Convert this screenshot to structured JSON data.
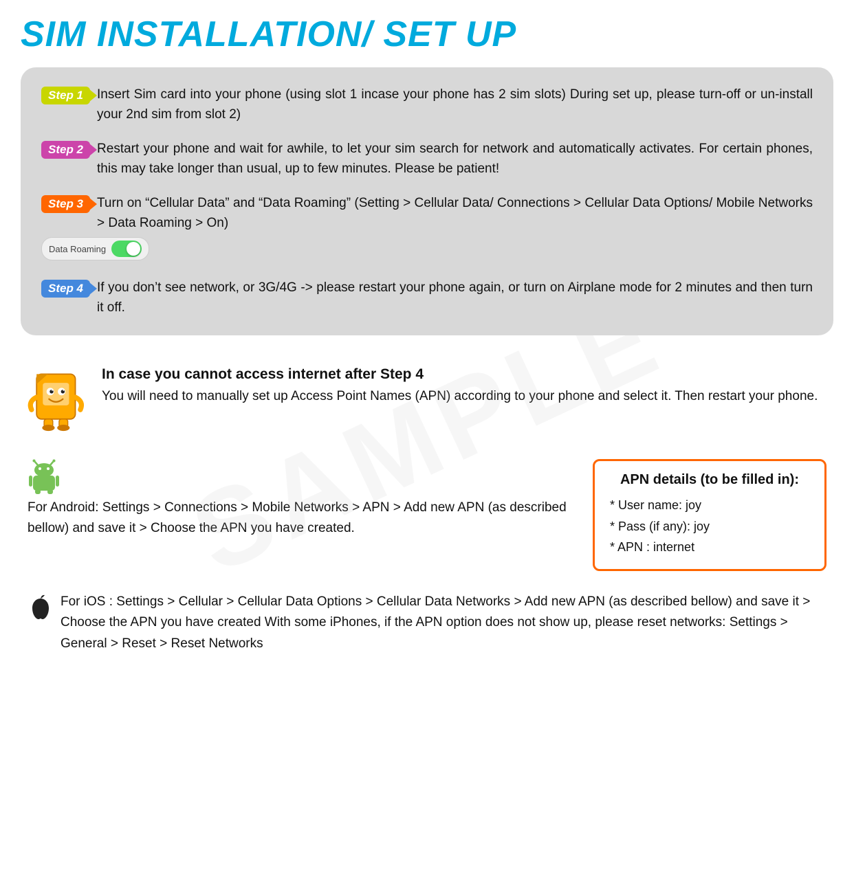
{
  "page": {
    "title": "SIM INSTALLATION/ SET UP"
  },
  "steps": [
    {
      "badge": "Step 1",
      "badge_class": "step1-badge",
      "text": "Insert Sim card into your phone (using slot 1 incase your phone has 2 sim slots) During set up, please turn-off or un-install your 2nd sim from slot 2)"
    },
    {
      "badge": "Step 2",
      "badge_class": "step2-badge",
      "text": "Restart your phone and wait for awhile, to let your sim search for network and  automatically activates. For certain phones, this may take longer than usual, up to few minutes. Please be patient!"
    },
    {
      "badge": "Step 3",
      "badge_class": "step3-badge",
      "text": "Turn  on “Cellular Data” and “Data Roaming” (Setting > Cellular Data/ Connections > Cellular Data Options/ Mobile Networks > Data Roaming > On)"
    },
    {
      "badge": "Step 4",
      "badge_class": "step4-badge",
      "text": "If you don’t see network, or 3G/4G -> please restart your phone again, or turn on Airplane mode for 2 minutes and then turn it off."
    }
  ],
  "toggle": {
    "label": "Data Roaming"
  },
  "notice": {
    "heading": "In case you cannot access internet after Step 4",
    "body": "You will need to manually set up Access Point Names (APN) according to your phone  and select it. Then restart your phone."
  },
  "android": {
    "text": "For Android: Settings > Connections > Mobile Networks >  APN > Add new APN  (as described bellow) and save it  > Choose the APN you have created."
  },
  "apn_box": {
    "title": "APN details (to be filled in):",
    "lines": [
      "* User name: joy",
      "* Pass (if any): joy",
      "* APN : internet"
    ]
  },
  "ios": {
    "text": "For iOS : Settings > Cellular > Cellular Data Options > Cellular Data Networks > Add new APN  (as described bellow) and save it  > Choose the APN you have created With some iPhones, if the APN option does not show up, please reset networks: Settings > General >  Reset > Reset Networks"
  }
}
